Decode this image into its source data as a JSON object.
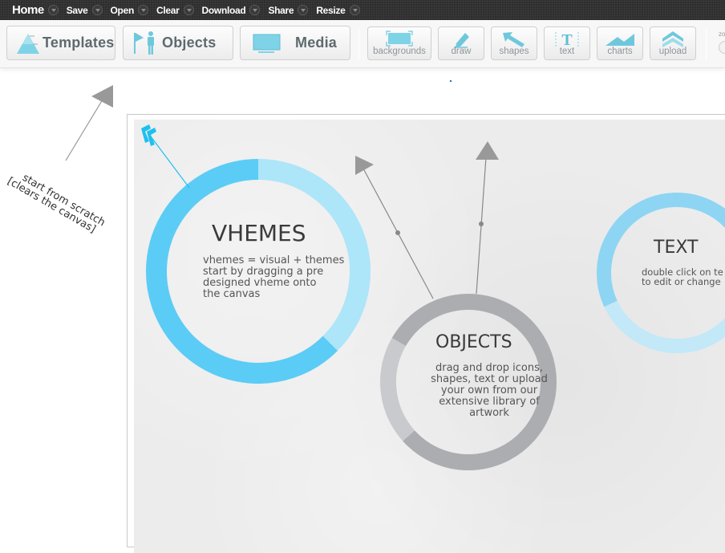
{
  "menu": [
    {
      "label": "Home"
    },
    {
      "label": "Save"
    },
    {
      "label": "Open"
    },
    {
      "label": "Clear"
    },
    {
      "label": "Download"
    },
    {
      "label": "Share"
    },
    {
      "label": "Resize"
    }
  ],
  "toolbar": {
    "big_buttons": [
      {
        "label": "Templates",
        "icon": "pyramid-chart-icon"
      },
      {
        "label": "Objects",
        "icon": "flag-person-icon"
      },
      {
        "label": "Media",
        "icon": "monitor-icon"
      }
    ],
    "tools": [
      {
        "label": "backgrounds",
        "icon": "background-frame-icon"
      },
      {
        "label": "draw",
        "icon": "pencil-icon"
      },
      {
        "label": "shapes",
        "icon": "arrow-shape-icon"
      },
      {
        "label": "text",
        "icon": "text-t-icon"
      },
      {
        "label": "charts",
        "icon": "area-chart-icon"
      },
      {
        "label": "upload",
        "icon": "upload-chevron-icon"
      }
    ],
    "zoom_label": "zo"
  },
  "hint": {
    "line1": "start from scratch",
    "line2": "[clears the canvas]"
  },
  "canvas": {
    "donuts": [
      {
        "id": "vhemes",
        "title": "VHEMES",
        "text": "vhemes = visual + themes\nstart by dragging a pre\ndesigned vheme onto\nthe canvas",
        "primary_fraction": 0.625,
        "primary_color": "#5bccf5",
        "secondary_color": "#ade5f9"
      },
      {
        "id": "objects",
        "title": "OBJECTS",
        "text": "drag and drop icons,\nshapes, text or upload\nyour own from our\nextensive library of\nartwork",
        "primary_fraction": 0.8,
        "primary_color": "#acadb1",
        "secondary_color": "#c9cacd"
      },
      {
        "id": "text",
        "title": "TEXT",
        "text": "double click on te\nto edit or change",
        "primary_fraction": 0.63,
        "primary_color": "#8dd5f3",
        "secondary_color": "#c3e8f8"
      }
    ]
  },
  "colors": {
    "accent_blue": "#1ec0f0",
    "arrow_gray": "#999999",
    "menubar": "#2e2e2e"
  }
}
